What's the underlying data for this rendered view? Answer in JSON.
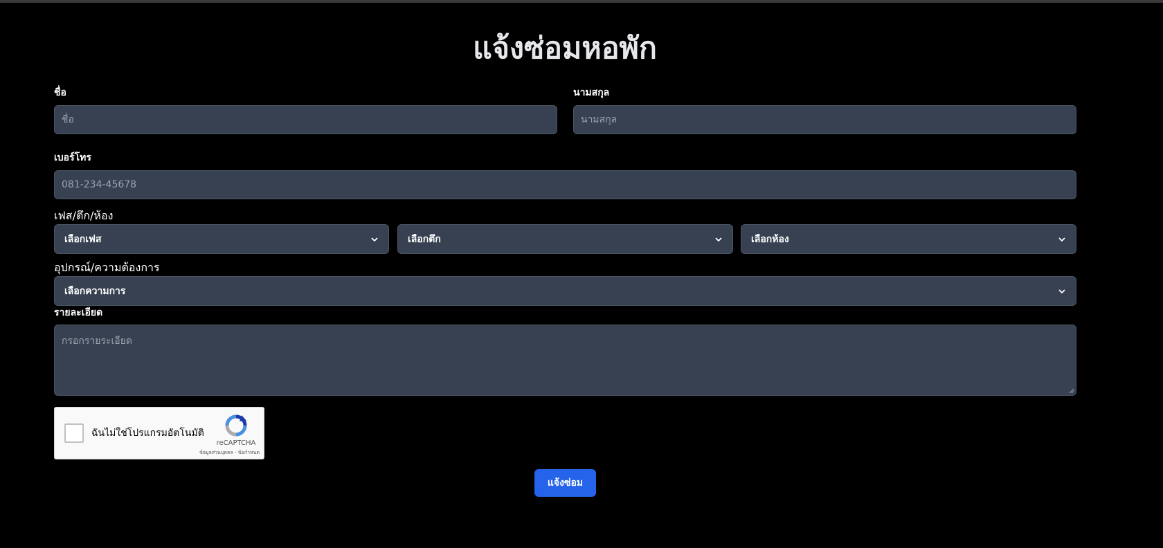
{
  "page": {
    "title": "แจ้งซ่อมหอพัก"
  },
  "form": {
    "first_name": {
      "label": "ชื่อ",
      "placeholder": "ชื่อ"
    },
    "last_name": {
      "label": "นามสกุล",
      "placeholder": "นามสกุล"
    },
    "phone": {
      "label": "เบอร์โทร",
      "placeholder": "081-234-45678"
    },
    "location": {
      "label": "เฟส/ตึก/ห้อง",
      "phase_selected": "เลือกเฟส",
      "building_selected": "เลือกตึก",
      "room_selected": "เลือกห้อง"
    },
    "equipment": {
      "label": "อุปกรณ์/ความต้องการ",
      "selected": "เลือกความการ"
    },
    "details": {
      "label": "รายละเอียด",
      "placeholder": "กรอกรายระเอียด"
    },
    "recaptcha": {
      "checkbox_label": "ฉันไม่ใช่โปรแกรมอัตโนมัติ",
      "brand": "reCAPTCHA",
      "links": "ข้อมูลส่วนบุคคล - ข้อกำหนด"
    },
    "submit_label": "แจ้งซ่อม"
  },
  "colors": {
    "background": "#000000",
    "field_bg": "#374151",
    "accent": "#2563eb"
  }
}
